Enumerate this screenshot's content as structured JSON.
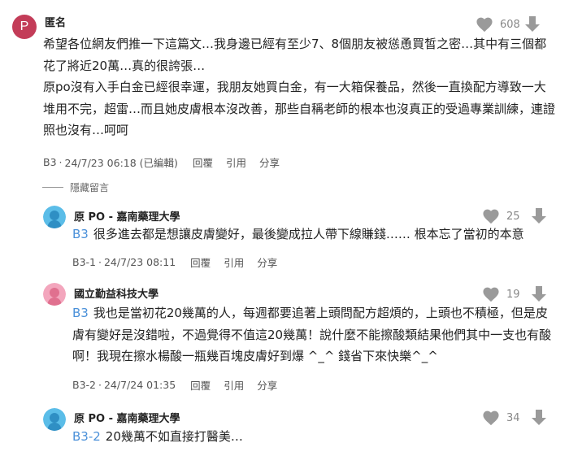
{
  "icons": {
    "heart": "heart-icon",
    "downvote": "arrow-down-icon",
    "avatar_male": "user-silhouette-icon",
    "avatar_female": "user-silhouette-icon"
  },
  "colors": {
    "avatar_p": "#c33c58",
    "avatar_blue": "#5bbde8",
    "avatar_pink": "#e0708f",
    "ref_link": "#4a90d9",
    "icon_gray": "#9a9a9a"
  },
  "main_comment": {
    "avatar_letter": "P",
    "author": "匿名",
    "likes": "608",
    "paragraphs": [
      "希望各位網友們推一下這篇文…我身邊已經有至少7、8個朋友被慫恿買皙之密…其中有三個都花了將近20萬…真的很誇張…",
      "原po沒有入手白金已經很幸運，我朋友她買白金，有一大箱保養品，然後一直換配方導致一大堆用不完，超雷…而且她皮膚根本沒改善，那些自稱老師的根本也沒真正的受過專業訓練，連證照也沒有…呵呵"
    ],
    "floor": "B3",
    "datetime": "24/7/23 06:18 (已編輯)",
    "actions": [
      "回覆",
      "引用",
      "分享"
    ]
  },
  "hidden_label": "隱藏留言",
  "replies": [
    {
      "author": "原 PO - 嘉南藥理大學",
      "likes": "25",
      "ref": "B3",
      "text": "很多進去都是想讓皮膚變好，最後變成拉人帶下線賺錢…… 根本忘了當初的本意",
      "floor": "B3-1",
      "datetime": "24/7/23 08:11",
      "actions": [
        "回覆",
        "引用",
        "分享"
      ]
    },
    {
      "author": "國立勤益科技大學",
      "likes": "19",
      "ref": "B3",
      "text": "我也是當初花20幾萬的人，每週都要追著上頭問配方超煩的，上頭也不積極，但是皮膚有變好是沒錯啦，不過覺得不值這20幾萬！說什麼不能擦酸類結果他們其中一支也有酸啊！我現在擦水楊酸一瓶幾百塊皮膚好到爆 ^_^ 錢省下來快樂^_^",
      "floor": "B3-2",
      "datetime": "24/7/24 01:35",
      "actions": [
        "回覆",
        "引用",
        "分享"
      ]
    },
    {
      "author": "原 PO - 嘉南藥理大學",
      "likes": "34",
      "ref": "B3-2",
      "text": "20幾萬不如直接打醫美…"
    }
  ]
}
